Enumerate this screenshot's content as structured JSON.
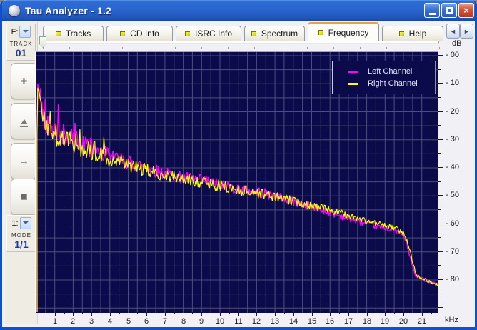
{
  "window": {
    "title": "Tau Analyzer - 1.2"
  },
  "titlebar": {
    "icon": "app-sphere-icon",
    "buttons": [
      {
        "name": "minimize",
        "icon": "minimize-icon"
      },
      {
        "name": "maximize",
        "icon": "maximize-icon"
      },
      {
        "name": "close",
        "icon": "close-icon",
        "glyph": "×"
      }
    ]
  },
  "tabs": [
    {
      "label": "Tracks",
      "active": false
    },
    {
      "label": "CD Info",
      "active": false
    },
    {
      "label": "ISRC Info",
      "active": false
    },
    {
      "label": "Spectrum",
      "active": false
    },
    {
      "label": "Frequency",
      "active": true
    },
    {
      "label": "Help",
      "active": false
    }
  ],
  "tab_scroll": {
    "left_glyph": "◄",
    "right_glyph": "►"
  },
  "sidebar": {
    "drive_combo": {
      "label": "F:"
    },
    "track_label": "TRACK",
    "track_number": "01",
    "buttons": [
      {
        "name": "add-track",
        "icon": "plus-icon",
        "glyph": "+"
      },
      {
        "name": "eject",
        "icon": "eject-icon"
      },
      {
        "name": "next",
        "icon": "arrow-right-icon",
        "glyph": "→"
      },
      {
        "name": "stop",
        "icon": "stop-icon"
      }
    ],
    "mode_combo": {
      "label": "1:"
    },
    "mode_label": "MODE",
    "mode_value": "1/1"
  },
  "chart_data": {
    "type": "line",
    "title": "Frequency response spectrum",
    "xlabel": "kHz",
    "ylabel": "dB",
    "xlim": [
      0,
      21.87
    ],
    "ylim": [
      -91.7,
      2.8
    ],
    "grid": {
      "on": true,
      "x_step_khz": 0.5,
      "y_step_db": 5,
      "color": "#4E4E7C"
    },
    "background": "#0B0B4B",
    "x_ticks": [
      1,
      2,
      3,
      4,
      5,
      6,
      7,
      8,
      9,
      10,
      11,
      12,
      13,
      14,
      15,
      16,
      17,
      18,
      19,
      20,
      21
    ],
    "y_ticks": {
      "values": [
        0,
        -10,
        -20,
        -30,
        -40,
        -50,
        -60,
        -70,
        -80
      ],
      "labels": [
        "- 00",
        "- 10",
        "- 20",
        "- 30",
        "- 40",
        "- 50",
        "- 60",
        "- 70",
        "- 80"
      ]
    },
    "legend": {
      "position": "top-right",
      "entries": [
        {
          "name": "Left Channel",
          "color": "#FF00FF"
        },
        {
          "name": "Right Channel",
          "color": "#FFFF00"
        }
      ]
    },
    "series": [
      {
        "name": "Left Channel",
        "color": "#FF00FF",
        "seed": 42,
        "envelope_points": [
          [
            0.03,
            -26
          ],
          [
            0.06,
            -14
          ],
          [
            0.1,
            -9.5
          ],
          [
            0.18,
            -13
          ],
          [
            0.3,
            -18.5
          ],
          [
            0.45,
            -22
          ],
          [
            0.6,
            -24
          ],
          [
            0.8,
            -25.5
          ],
          [
            1,
            -26.5
          ],
          [
            1.3,
            -27.5
          ],
          [
            1.6,
            -28.5
          ],
          [
            2,
            -30.5
          ],
          [
            2.5,
            -31.5
          ],
          [
            3,
            -33
          ],
          [
            3.5,
            -34
          ],
          [
            4,
            -35.5
          ],
          [
            4.5,
            -37
          ],
          [
            5,
            -38
          ],
          [
            6,
            -40
          ],
          [
            7,
            -42
          ],
          [
            8,
            -43.5
          ],
          [
            9,
            -44.5
          ],
          [
            10,
            -46
          ],
          [
            11,
            -47.5
          ],
          [
            12,
            -48.5
          ],
          [
            13,
            -50
          ],
          [
            14,
            -52
          ],
          [
            15,
            -54
          ],
          [
            16,
            -56
          ],
          [
            17,
            -58
          ],
          [
            18,
            -60
          ],
          [
            19,
            -61.5
          ],
          [
            19.6,
            -62.5
          ],
          [
            20,
            -64
          ],
          [
            20.2,
            -67.5
          ],
          [
            20.45,
            -74
          ],
          [
            20.65,
            -78.5
          ],
          [
            21,
            -79.5
          ],
          [
            21.4,
            -80.5
          ],
          [
            21.87,
            -81.5
          ]
        ]
      },
      {
        "name": "Right Channel",
        "color": "#FFFF00",
        "seed": 1337,
        "envelope_points": [
          [
            0.03,
            -27
          ],
          [
            0.06,
            -15
          ],
          [
            0.1,
            -11
          ],
          [
            0.18,
            -14.5
          ],
          [
            0.3,
            -20
          ],
          [
            0.45,
            -23.5
          ],
          [
            0.6,
            -25.5
          ],
          [
            0.8,
            -27
          ],
          [
            1,
            -28
          ],
          [
            1.3,
            -29
          ],
          [
            1.6,
            -30
          ],
          [
            2,
            -31.8
          ],
          [
            2.5,
            -32.8
          ],
          [
            3,
            -34.2
          ],
          [
            3.5,
            -35.2
          ],
          [
            4,
            -36.6
          ],
          [
            4.5,
            -38
          ],
          [
            5,
            -39
          ],
          [
            6,
            -41
          ],
          [
            7,
            -42.6
          ],
          [
            8,
            -44
          ],
          [
            9,
            -45
          ],
          [
            10,
            -46.4
          ],
          [
            11,
            -47.8
          ],
          [
            12,
            -48.8
          ],
          [
            13,
            -50.3
          ],
          [
            14,
            -51.8
          ],
          [
            15,
            -53.3
          ],
          [
            16,
            -55
          ],
          [
            17,
            -57
          ],
          [
            18,
            -59
          ],
          [
            19,
            -60.5
          ],
          [
            19.6,
            -61.5
          ],
          [
            20,
            -63.5
          ],
          [
            20.25,
            -67
          ],
          [
            20.5,
            -73.5
          ],
          [
            20.7,
            -78
          ],
          [
            21,
            -79.3
          ],
          [
            21.4,
            -80.6
          ],
          [
            21.87,
            -81.8
          ]
        ]
      }
    ],
    "noise": {
      "amplitude_points": [
        [
          0.03,
          3
        ],
        [
          0.3,
          4
        ],
        [
          0.8,
          4.5
        ],
        [
          1.5,
          4.2
        ],
        [
          2.5,
          3.8
        ],
        [
          3.5,
          3.2
        ],
        [
          5,
          2.6
        ],
        [
          7,
          2.2
        ],
        [
          9,
          2.2
        ],
        [
          12,
          1.9
        ],
        [
          14,
          1.6
        ],
        [
          16,
          1.3
        ],
        [
          18,
          1.1
        ],
        [
          19.5,
          0.9
        ],
        [
          20.4,
          0.7
        ],
        [
          21.87,
          0.5
        ]
      ],
      "step_khz": 0.045,
      "spike_probability": 0.12,
      "spike_max_db": 5.5,
      "spike_below_khz": 4.5
    }
  }
}
